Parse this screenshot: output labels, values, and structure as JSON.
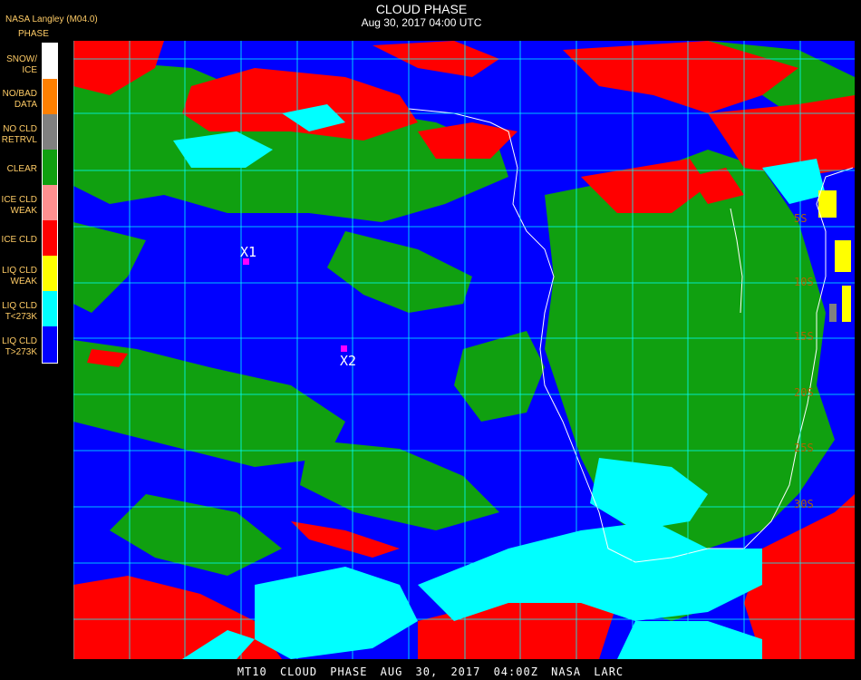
{
  "header": {
    "source": "NASA Langley (M04.0)",
    "phase_label": "PHASE",
    "title": "CLOUD PHASE",
    "subtitle": "Aug 30, 2017 04:00 UTC"
  },
  "legend": {
    "items": [
      {
        "label": "SNOW/\nICE",
        "color": "#ffffff"
      },
      {
        "label": "NO/BAD\nDATA",
        "color": "#ff8000"
      },
      {
        "label": "NO CLD\nRETRVL",
        "color": "#808080"
      },
      {
        "label": "CLEAR",
        "color": "#10a010"
      },
      {
        "label": "ICE CLD\nWEAK",
        "color": "#ff9090"
      },
      {
        "label": "ICE CLD",
        "color": "#ff0000"
      },
      {
        "label": "LIQ CLD\nWEAK",
        "color": "#ffff00"
      },
      {
        "label": "LIQ CLD\nT<273K",
        "color": "#00ffff"
      },
      {
        "label": "LIQ CLD\nT>273K",
        "color": "#0000ff"
      }
    ]
  },
  "map": {
    "markers": [
      {
        "label": "X1"
      },
      {
        "label": "X2"
      }
    ],
    "grid_color": "#00ffff",
    "lat_labels": [
      "5S",
      "10S",
      "15S",
      "20S",
      "25S",
      "30S"
    ]
  },
  "footer": {
    "text": "MT10  CLOUD PHASE   AUG 30, 2017 04:00Z   NASA LARC"
  }
}
